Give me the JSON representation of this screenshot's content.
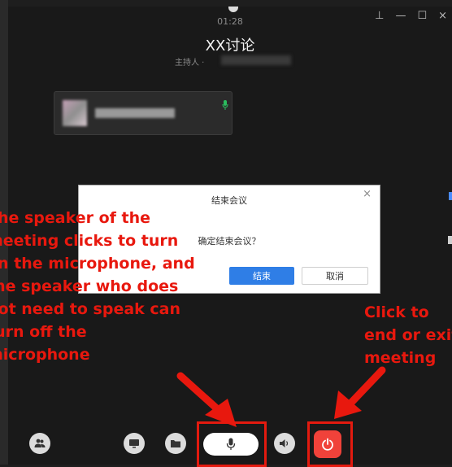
{
  "window": {
    "timer": "01:28",
    "title": "XX讨论",
    "host_label": "主持人 ·",
    "controls": {
      "pin": "⊥",
      "minimize": "—",
      "maximize": "☐",
      "close": "×"
    }
  },
  "participant": {
    "mic_state": "active"
  },
  "dialog": {
    "title": "结束会议",
    "close": "×",
    "message": "确定结束会议？",
    "ok_label": "结束",
    "cancel_label": "取消"
  },
  "annotations": {
    "left_lines": [
      "The speaker of the",
      "meeting clicks to turn",
      "on the microphone, and",
      "the speaker who does",
      "not need to speak can",
      "turn off the",
      "microphone"
    ],
    "right_lines": [
      "Click to",
      "end or exit",
      "meeting"
    ]
  },
  "toolbar": {
    "participants_icon": "people-icon",
    "share_icon": "share-screen-icon",
    "folder_icon": "folder-icon",
    "mic_icon": "microphone-icon",
    "speaker_icon": "speaker-icon",
    "end_icon": "power-icon"
  },
  "colors": {
    "background": "#191919",
    "annotation": "#e8180e",
    "primary_button": "#2f7ee6",
    "end_button": "#f0423a",
    "mic_active": "#2bbd5e"
  }
}
